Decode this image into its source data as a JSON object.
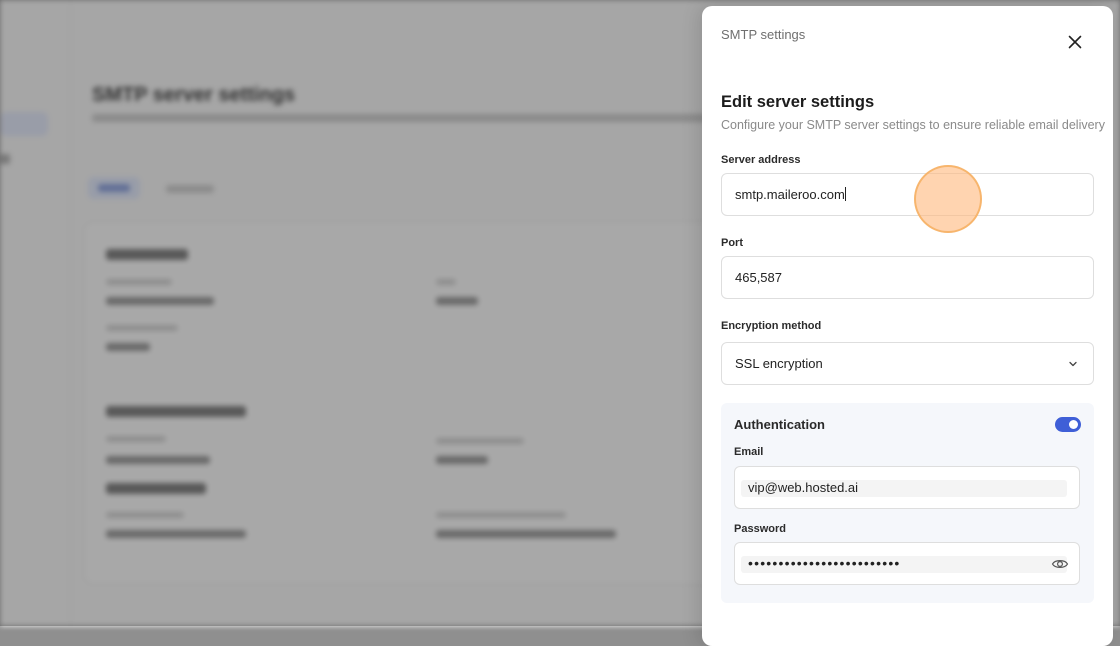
{
  "background_page": {
    "title": "SMTP server settings"
  },
  "drawer": {
    "title": "SMTP settings",
    "section_title": "Edit server settings",
    "section_subtitle": "Configure your SMTP server settings to ensure reliable email delivery",
    "server_address": {
      "label": "Server address",
      "value": "smtp.maileroo.com"
    },
    "port": {
      "label": "Port",
      "value": "465,587"
    },
    "encryption": {
      "label": "Encryption method",
      "selected": "SSL encryption"
    },
    "authentication": {
      "title": "Authentication",
      "enabled": true,
      "email_label": "Email",
      "email_value": "vip@web.hosted.ai",
      "password_label": "Password",
      "password_masked": "•••••••••••••••••••••••••"
    }
  },
  "icons": {
    "close": "close-icon",
    "dropdown": "chevron-down-icon",
    "show_password": "eye-icon"
  },
  "colors": {
    "accent": "#3f5fd7",
    "click_indicator": "#ffba80"
  }
}
